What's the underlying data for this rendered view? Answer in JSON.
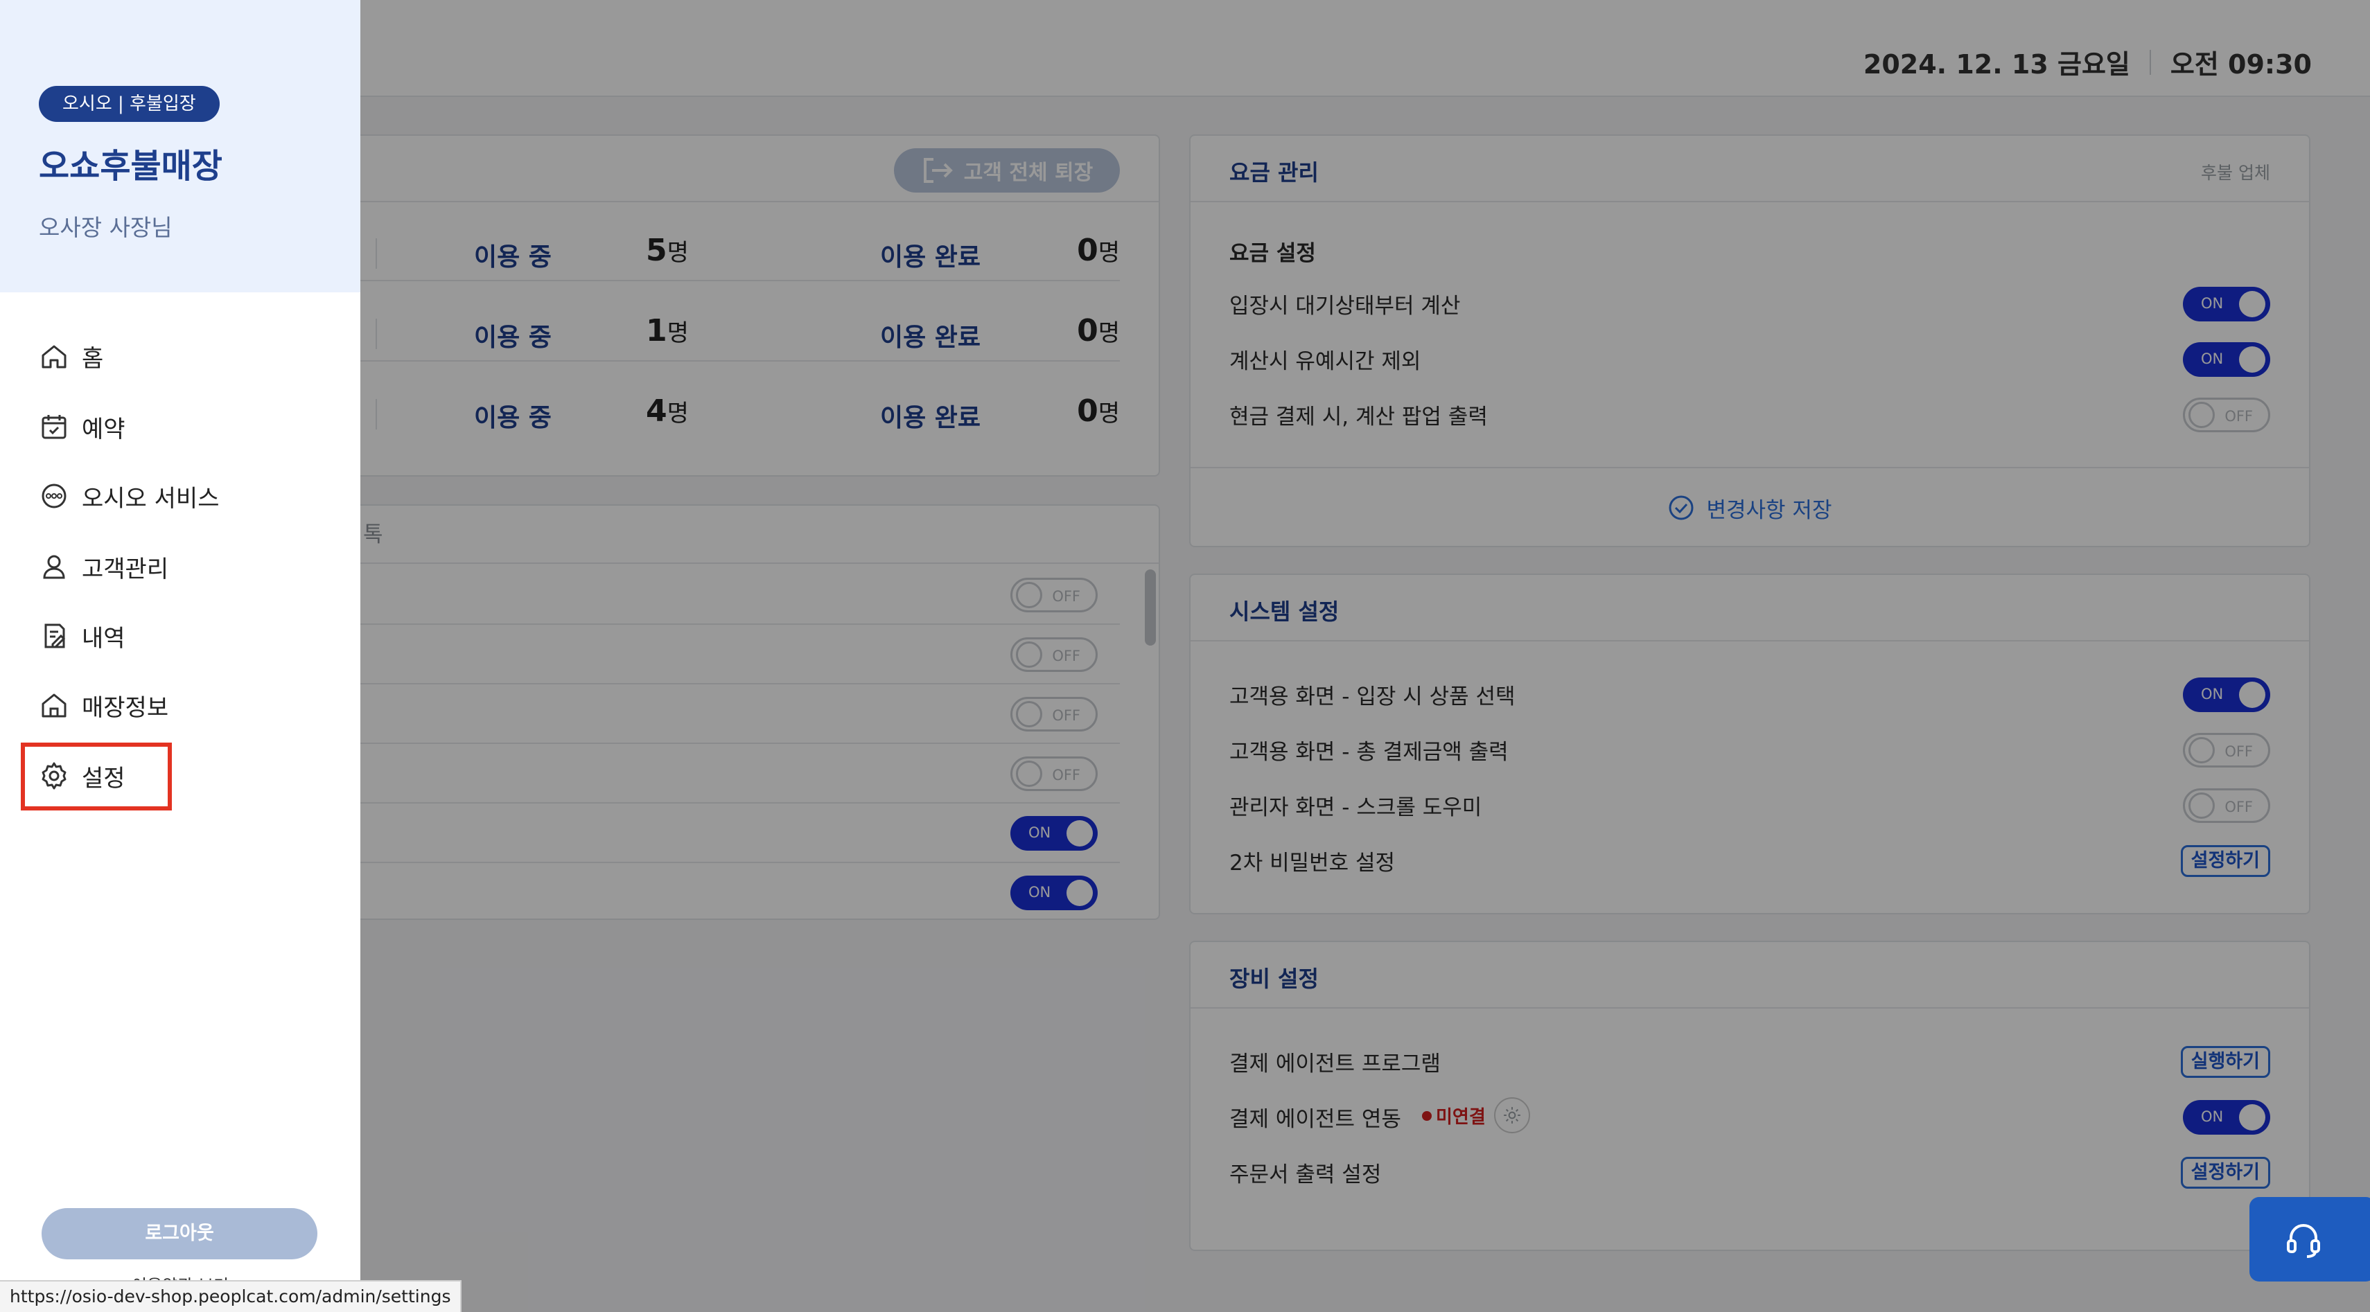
{
  "header": {
    "date": "2024. 12. 13 금요일",
    "time": "오전 09:30"
  },
  "usage": {
    "button": "고객 전체 퇴장",
    "rows": [
      {
        "in_use_label": "이용 중",
        "in_use": "5",
        "done_label": "이용 완료",
        "done": "0",
        "unit": "명"
      },
      {
        "in_use_label": "이용 중",
        "in_use": "1",
        "done_label": "이용 완료",
        "done": "0",
        "unit": "명"
      },
      {
        "in_use_label": "이용 중",
        "in_use": "4",
        "done_label": "이용 완료",
        "done": "0",
        "unit": "명"
      }
    ]
  },
  "left_settings": {
    "header_fragment": "톡",
    "toggles": [
      "OFF",
      "OFF",
      "OFF",
      "OFF",
      "ON",
      "ON"
    ]
  },
  "fee": {
    "title": "요금 관리",
    "subtitle": "후불 업체",
    "section": "요금 설정",
    "rows": [
      {
        "label": "입장시 대기상태부터 계산",
        "state": "ON"
      },
      {
        "label": "계산시 유예시간 제외",
        "state": "ON"
      },
      {
        "label": "현금 결제 시, 계산 팝업 출력",
        "state": "OFF"
      }
    ],
    "save": "변경사항 저장"
  },
  "system": {
    "title": "시스템 설정",
    "rows": [
      {
        "label": "고객용 화면 - 입장 시 상품 선택",
        "state": "ON"
      },
      {
        "label": "고객용 화면 - 총 결제금액 출력",
        "state": "OFF"
      },
      {
        "label": "관리자 화면 - 스크롤 도우미",
        "state": "OFF"
      }
    ],
    "password_label": "2차 비밀번호 설정",
    "password_button": "설정하기"
  },
  "equipment": {
    "title": "장비 설정",
    "agent_program": "결제 에이전트 프로그램",
    "run_button": "실행하기",
    "agent_link": "결제 에이전트 연동",
    "agent_status": "미연결",
    "agent_state": "ON",
    "order_print": "주문서 출력 설정",
    "order_button": "설정하기"
  },
  "sidebar": {
    "badge": "오시오 | 후불입장",
    "store_name": "오쇼후불매장",
    "owner": "오사장 사장님",
    "items": [
      {
        "label": "홈",
        "icon": "home-icon"
      },
      {
        "label": "예약",
        "icon": "calendar-icon"
      },
      {
        "label": "오시오 서비스",
        "icon": "osio-service-icon"
      },
      {
        "label": "고객관리",
        "icon": "user-icon"
      },
      {
        "label": "내역",
        "icon": "history-icon"
      },
      {
        "label": "매장정보",
        "icon": "store-icon"
      },
      {
        "label": "설정",
        "icon": "gear-icon"
      }
    ],
    "logout": "로그아웃",
    "terms": "이용약관 보기"
  },
  "status_bar": {
    "url": "https://osio-dev-shop.peoplcat.com/admin/settings"
  },
  "colors": {
    "brand": "#1e3f8c",
    "toggle_on": "#1a2fd6",
    "highlight": "#e33322",
    "fab": "#1e5cbf"
  }
}
